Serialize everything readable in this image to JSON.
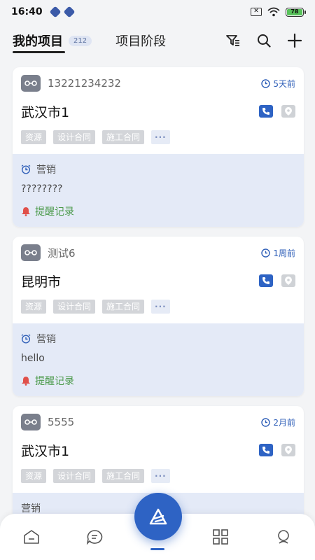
{
  "status_bar": {
    "time": "16:40",
    "battery": "78"
  },
  "header": {
    "tabs": [
      {
        "label": "我的项目",
        "badge": "212"
      },
      {
        "label": "项目阶段"
      }
    ]
  },
  "projects": [
    {
      "owner": "13221234232",
      "time": "5天前",
      "city": "武汉市1",
      "tags": [
        "资源",
        "设计合同",
        "施工合同"
      ],
      "more": "···",
      "stage": "营销",
      "note": "????????",
      "remind": "提醒记录"
    },
    {
      "owner": "测试6",
      "time": "1周前",
      "city": "昆明市",
      "tags": [
        "资源",
        "设计合同",
        "施工合同"
      ],
      "more": "···",
      "stage": "营销",
      "note": "hello",
      "remind": "提醒记录"
    },
    {
      "owner": "5555",
      "time": "2月前",
      "city": "武汉市1",
      "tags": [
        "资源",
        "设计合同",
        "施工合同"
      ],
      "more": "···",
      "stage": "营销",
      "note": "",
      "remind": ""
    }
  ],
  "colors": {
    "accent": "#2e63c4",
    "remind_green": "#4b9a4b",
    "bell_red": "#e0504a",
    "stage_bg": "#e4eaf7"
  },
  "icons": [
    "filter-icon",
    "search-icon",
    "plus-icon",
    "phone-icon",
    "location-icon",
    "clock-icon",
    "alarm-icon",
    "bell-icon",
    "home-icon",
    "chat-icon",
    "grid-icon",
    "profile-icon",
    "fab-logo-icon"
  ]
}
